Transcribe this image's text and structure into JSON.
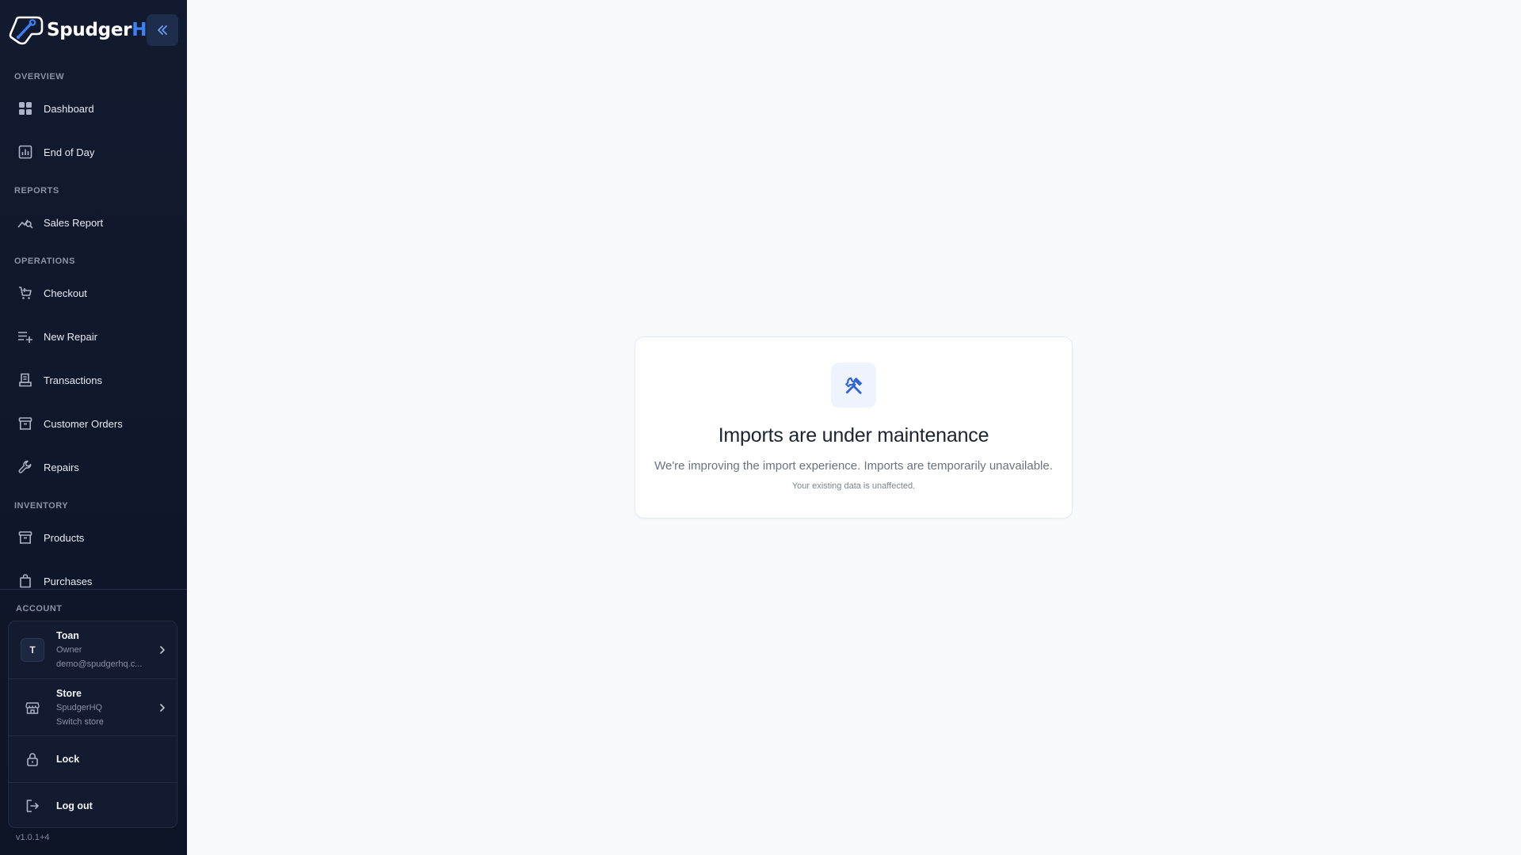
{
  "brand": {
    "name_primary": "Spudger",
    "name_accent": "HQ",
    "accent_color": "#3b82f6"
  },
  "sidebar": {
    "collapse_icon": "double-chevron-left-icon",
    "sections": [
      {
        "label": "OVERVIEW"
      },
      {
        "label": "REPORTS"
      },
      {
        "label": "OPERATIONS"
      },
      {
        "label": "INVENTORY"
      }
    ],
    "items": [
      {
        "label": "Dashboard",
        "icon": "grid-icon"
      },
      {
        "label": "End of Day",
        "icon": "chart-box-icon"
      },
      {
        "label": "Sales Report",
        "icon": "trend-search-icon"
      },
      {
        "label": "Checkout",
        "icon": "cart-plus-icon"
      },
      {
        "label": "New Repair",
        "icon": "list-plus-icon"
      },
      {
        "label": "Transactions",
        "icon": "receipt-icon"
      },
      {
        "label": "Customer Orders",
        "icon": "archive-box-icon"
      },
      {
        "label": "Repairs",
        "icon": "wrench-icon"
      },
      {
        "label": "Products",
        "icon": "box-icon"
      },
      {
        "label": "Purchases",
        "icon": "bag-icon"
      }
    ]
  },
  "account": {
    "label": "ACCOUNT",
    "user": {
      "initial": "T",
      "name": "Toan",
      "role": "Owner",
      "email": "demo@spudgerhq.c..."
    },
    "store": {
      "title": "Store",
      "name": "SpudgerHQ",
      "action": "Switch store"
    },
    "lock_label": "Lock",
    "logout_label": "Log out",
    "version": "v1.0.1+4"
  },
  "notice": {
    "icon": "tools-icon",
    "title": "Imports are under maintenance",
    "description": "We're improving the import experience. Imports are temporarily unavailable.",
    "note": "Your existing data is unaffected."
  }
}
